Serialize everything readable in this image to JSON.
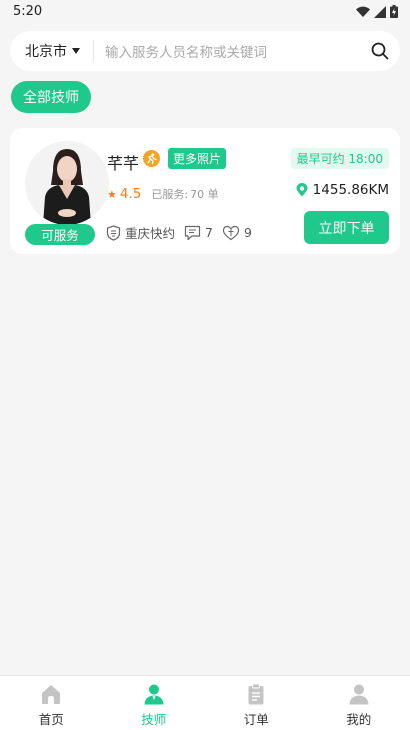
{
  "status_bar": {
    "time": "5:20"
  },
  "search": {
    "city": "北京市",
    "placeholder": "输入服务人员名称或关键词"
  },
  "filter": {
    "all_label": "全部技师"
  },
  "card": {
    "name": "芊芊",
    "more_photos": "更多照片",
    "status": "可服务",
    "rating": "4.5",
    "served_label": "已服务:",
    "served_count": "70 单",
    "city_tag": "重庆快约",
    "comments": "7",
    "likes": "9",
    "earliest": "最早可约 18:00",
    "distance": "1455.86KM",
    "order_button": "立即下单"
  },
  "tabbar": {
    "items": [
      {
        "label": "首页",
        "icon": "home-icon"
      },
      {
        "label": "技师",
        "icon": "technician-icon"
      },
      {
        "label": "订单",
        "icon": "order-icon"
      },
      {
        "label": "我的",
        "icon": "profile-icon"
      }
    ],
    "active_index": 1
  },
  "colors": {
    "accent": "#1fc98b",
    "rating": "#ff7a1a",
    "badge": "#f4a623",
    "inactive_icon": "#c4c4c4"
  }
}
